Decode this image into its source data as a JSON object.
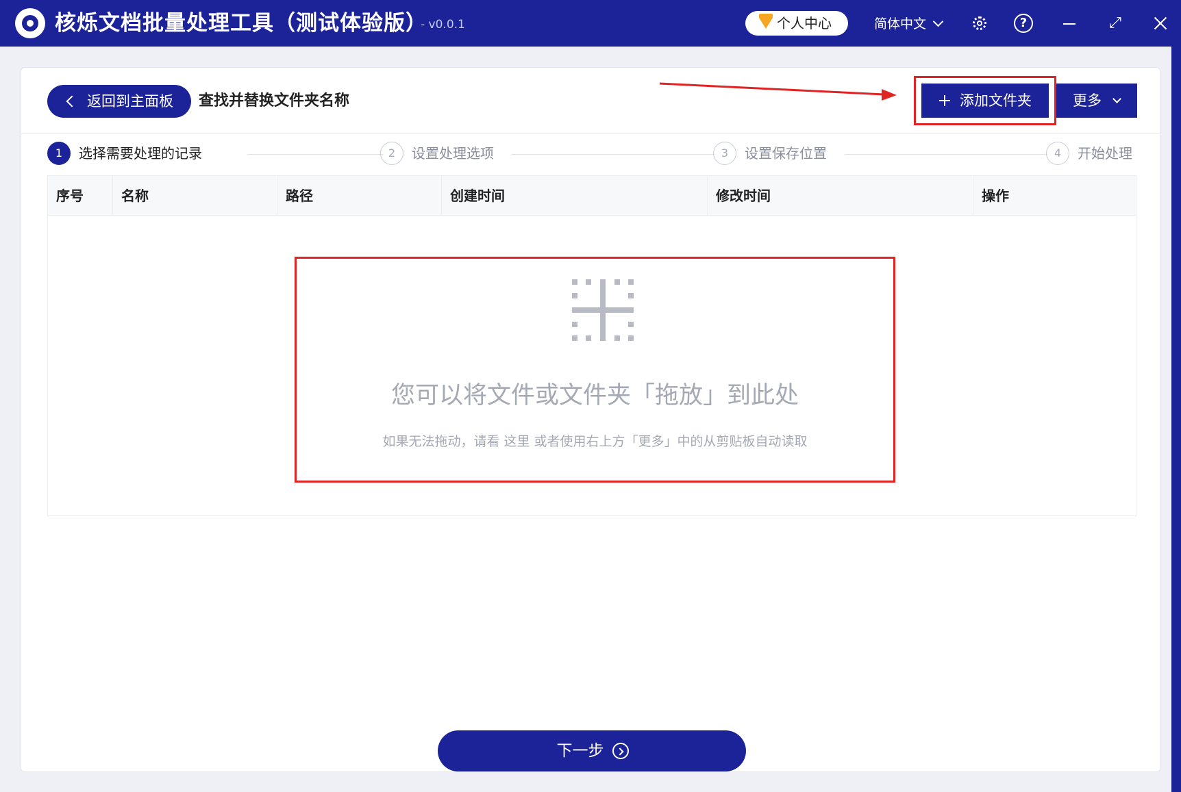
{
  "app": {
    "title": "核烁文档批量处理工具（测试体验版）",
    "version": "- v0.0.1",
    "user_center": "个人中心",
    "language": "简体中文"
  },
  "header": {
    "back_label": "返回到主面板",
    "page_title": "查找并替换文件夹名称",
    "add_folder_label": "添加文件夹",
    "more_label": "更多"
  },
  "steps": [
    {
      "number": "1",
      "label": "选择需要处理的记录",
      "active": true
    },
    {
      "number": "2",
      "label": "设置处理选项",
      "active": false
    },
    {
      "number": "3",
      "label": "设置保存位置",
      "active": false
    },
    {
      "number": "4",
      "label": "开始处理",
      "active": false
    }
  ],
  "table": {
    "columns": [
      "序号",
      "名称",
      "路径",
      "创建时间",
      "修改时间",
      "操作"
    ],
    "rows": []
  },
  "dropzone": {
    "title": "您可以将文件或文件夹「拖放」到此处",
    "hint": "如果无法拖动，请看  这里  或者使用右上方「更多」中的从剪贴板自动读取"
  },
  "footer": {
    "next_label": "下一步"
  },
  "colors": {
    "primary": "#1c2399",
    "highlight": "#e02424",
    "vip": "#f5a623"
  },
  "icons": [
    "app-logo-icon",
    "vip-diamond-icon",
    "chevron-down-icon",
    "gear-icon",
    "help-icon",
    "minimize-icon",
    "maximize-icon",
    "close-icon",
    "chevron-left-icon",
    "plus-icon",
    "drop-target-icon",
    "arrow-right-circle-icon"
  ]
}
